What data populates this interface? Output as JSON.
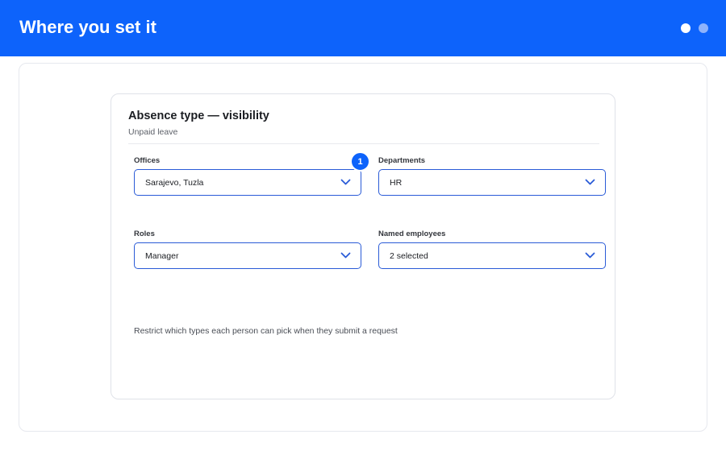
{
  "header": {
    "title": "Where you set it"
  },
  "card": {
    "title": "Absence type — visibility",
    "subtitle": "Unpaid leave"
  },
  "fields": {
    "offices": {
      "label": "Offices",
      "value": "Sarajevo, Tuzla"
    },
    "departments": {
      "label": "Departments",
      "value": "HR"
    },
    "roles": {
      "label": "Roles",
      "value": "Manager"
    },
    "named_employees": {
      "label": "Named employees",
      "value": "2 selected"
    }
  },
  "badge": {
    "number": "1"
  },
  "helper_text": "Restrict which types each person can pick when they submit a request",
  "colors": {
    "brand_blue": "#0d63fb",
    "input_border": "#2a5bd7",
    "dot_inactive": "#8fb3fb"
  },
  "icons": {
    "chevron": "chevron-down-icon",
    "pager_dots": "pager-dot-icon"
  }
}
